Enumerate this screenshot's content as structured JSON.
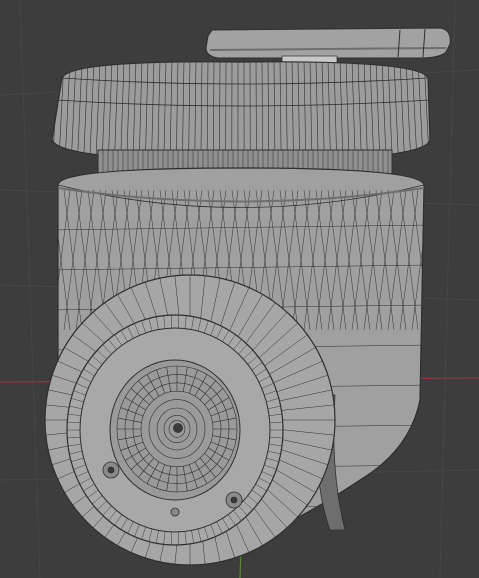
{
  "viewport": {
    "background_color": "#3d3d3d",
    "grid_color": "#474747",
    "x_axis_color": "#8a3a3a",
    "y_axis_color": "#5a8a2a"
  },
  "model": {
    "mesh_color": "#9a9a9a",
    "wire_color": "#2e2e2e",
    "shadow_color": "#6e6e6e",
    "highlight_color": "#b4b4b4",
    "parts": [
      "base-plate",
      "mount-cap",
      "neck-ring",
      "body-shell",
      "head-sphere",
      "lens-assembly",
      "screws"
    ]
  }
}
